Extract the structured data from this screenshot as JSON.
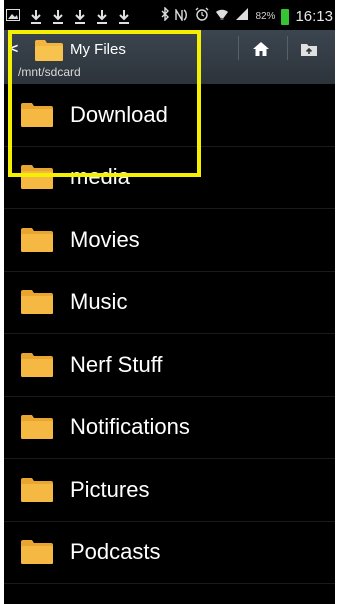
{
  "status_bar": {
    "battery_percent": "82%",
    "time": "16:13"
  },
  "header": {
    "title": "My Files",
    "path": "/mnt/sdcard"
  },
  "folders": [
    {
      "label": "Download"
    },
    {
      "label": "media"
    },
    {
      "label": "Movies"
    },
    {
      "label": "Music"
    },
    {
      "label": "Nerf Stuff"
    },
    {
      "label": "Notifications"
    },
    {
      "label": "Pictures"
    },
    {
      "label": "Podcasts"
    }
  ],
  "colors": {
    "highlight": "#f5f000",
    "folder": "#f2b640",
    "battery": "#34c434"
  },
  "icons": [
    "gallery-icon",
    "download-icon",
    "bluetooth-icon",
    "nfc-icon",
    "alarm-icon",
    "wifi-icon",
    "signal-icon",
    "battery-icon",
    "back-icon",
    "folder-icon",
    "home-icon",
    "folder-up-icon"
  ]
}
